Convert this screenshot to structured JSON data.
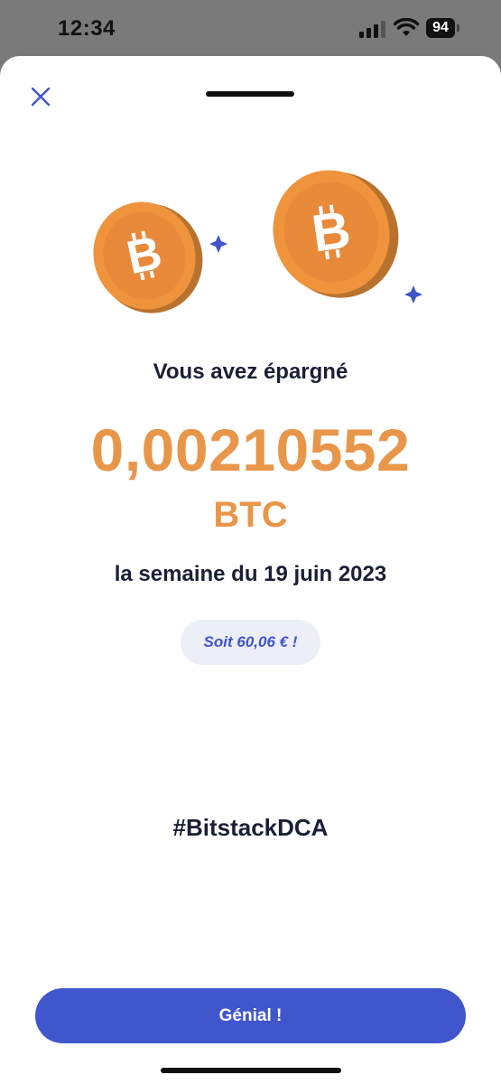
{
  "status_bar": {
    "time": "12:34",
    "battery": "94"
  },
  "sheet": {
    "saved_label": "Vous avez épargné",
    "amount": "0,00210552",
    "unit": "BTC",
    "week_label": "la semaine du 19 juin 2023",
    "equivalent": "Soit 60,06 € !",
    "hashtag": "#BitstackDCA",
    "confirm_button": "Génial !"
  },
  "colors": {
    "accent_blue": "#3f56cc",
    "bitcoin_orange": "#e8964a",
    "text_dark": "#1a1f36"
  },
  "icons": {
    "close": "close-icon",
    "coin": "bitcoin-coin-icon",
    "sparkle": "sparkle-icon"
  }
}
